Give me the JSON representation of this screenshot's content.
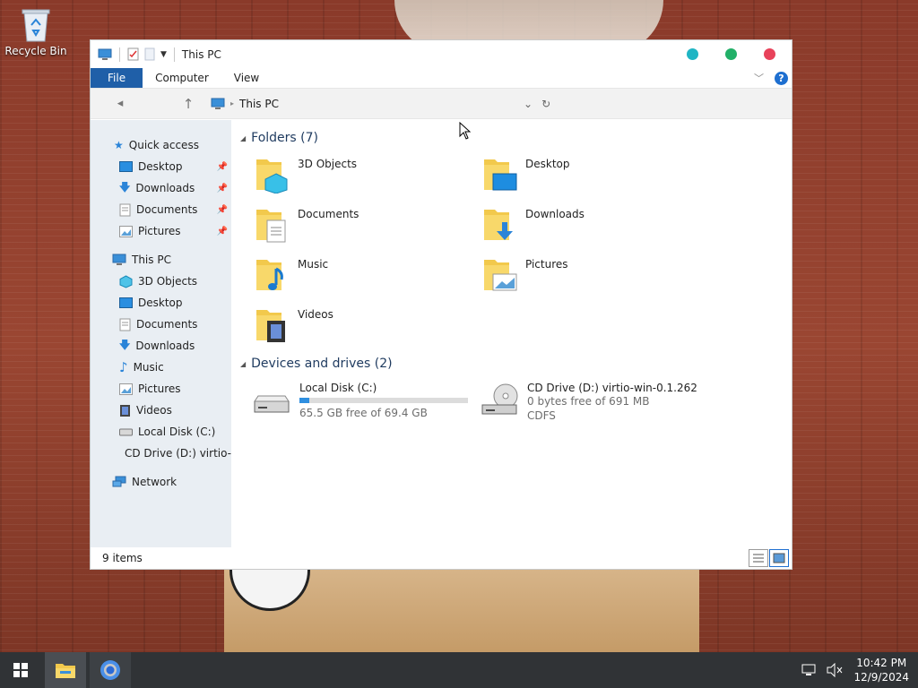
{
  "desktop": {
    "recycle_bin_label": "Recycle Bin"
  },
  "window": {
    "title": "This PC",
    "controls_colors": {
      "minimize": "#1fb5c4",
      "maximize": "#22b068",
      "close": "#e8425a"
    }
  },
  "ribbon": {
    "tabs": [
      "File",
      "Computer",
      "View"
    ],
    "help_label": "?"
  },
  "address": {
    "path": "This PC"
  },
  "nav_pane": {
    "quick_access": "Quick access",
    "quick_items": [
      "Desktop",
      "Downloads",
      "Documents",
      "Pictures"
    ],
    "this_pc": "This PC",
    "pc_items": [
      "3D Objects",
      "Desktop",
      "Documents",
      "Downloads",
      "Music",
      "Pictures",
      "Videos",
      "Local Disk (C:)",
      "CD Drive (D:) virtio-"
    ],
    "network": "Network"
  },
  "content": {
    "folders_header": "Folders (7)",
    "folders": [
      "3D Objects",
      "Desktop",
      "Documents",
      "Downloads",
      "Music",
      "Pictures",
      "Videos"
    ],
    "devices_header": "Devices and drives (2)",
    "drives": [
      {
        "name": "Local Disk (C:)",
        "free": "65.5 GB free of 69.4 GB",
        "used_fraction": 0.06
      },
      {
        "name": "CD Drive (D:) virtio-win-0.1.262",
        "free": "0 bytes free of 691 MB",
        "fs": "CDFS"
      }
    ]
  },
  "status": {
    "items": "9 items"
  },
  "taskbar": {
    "time": "10:42 PM",
    "date": "12/9/2024"
  }
}
